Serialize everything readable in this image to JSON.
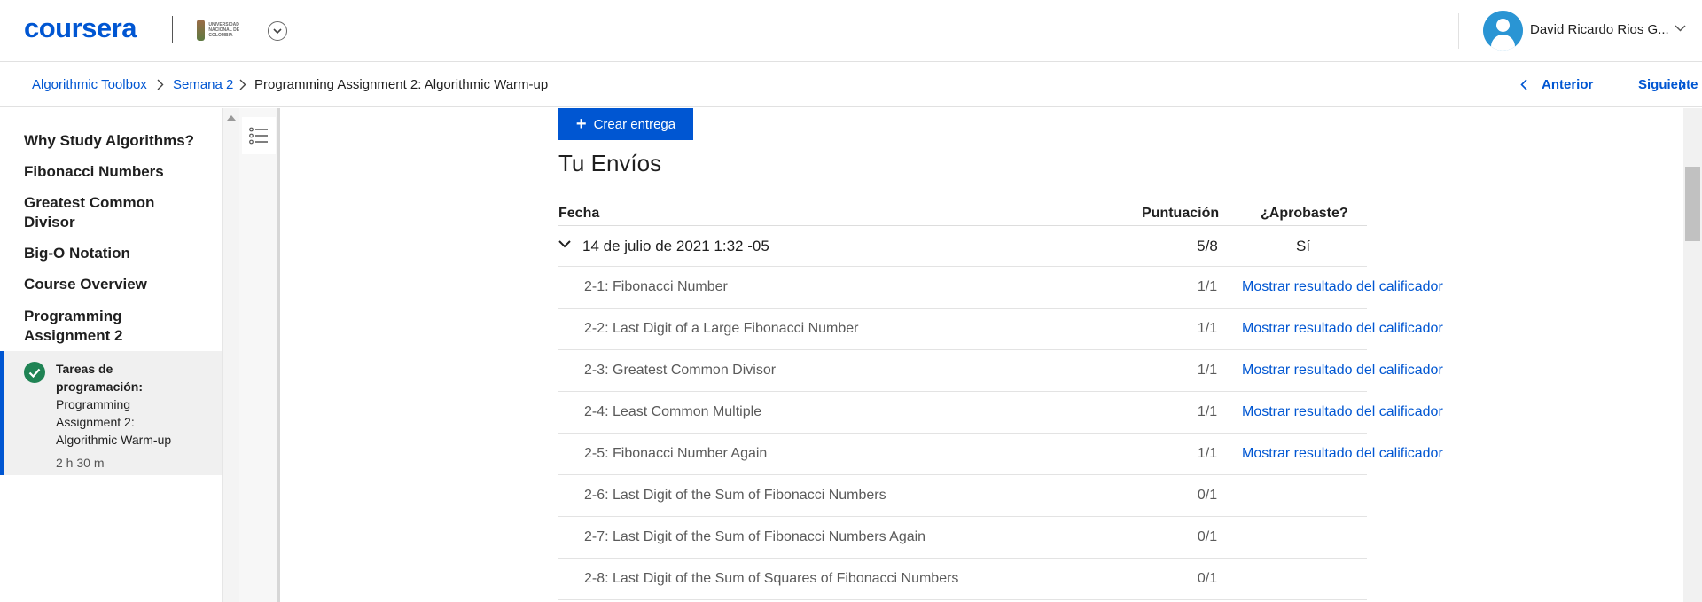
{
  "header": {
    "logo_text": "coursera",
    "partner_text": "UNIVERSIDAD NACIONAL DE COLOMBIA",
    "user_name": "David Ricardo Rios G..."
  },
  "breadcrumb": {
    "items": [
      "Algorithmic Toolbox",
      "Semana 2",
      "Programming Assignment 2: Algorithmic Warm-up"
    ],
    "prev_label": "Anterior",
    "next_label": "Siguiente"
  },
  "sidebar": {
    "items": [
      "Why Study Algorithms?",
      "Fibonacci Numbers",
      "Greatest Common Divisor",
      "Big-O Notation",
      "Course Overview",
      "Programming Assignment 2"
    ],
    "active": {
      "type": "Tareas de programación:",
      "title": "Programming Assignment 2: Algorithmic Warm-up",
      "duration": "2 h 30 m"
    }
  },
  "main": {
    "create_button": "Crear entrega",
    "section_title": "Tu Envíos",
    "columns": {
      "date": "Fecha",
      "score": "Puntuación",
      "passed": "¿Aprobaste?"
    },
    "submission": {
      "date": "14 de julio de 2021 1:32 -05",
      "score": "5/8",
      "passed": "Sí"
    },
    "link_label": "Mostrar resultado del calificador",
    "rows": [
      {
        "name": "2-1: Fibonacci Number",
        "score": "1/1",
        "link": "Mostrar resultado del calificador"
      },
      {
        "name": "2-2: Last Digit of a Large Fibonacci Number",
        "score": "1/1",
        "link": "Mostrar resultado del calificador"
      },
      {
        "name": "2-3: Greatest Common Divisor",
        "score": "1/1",
        "link": "Mostrar resultado del calificador"
      },
      {
        "name": "2-4: Least Common Multiple",
        "score": "1/1",
        "link": "Mostrar resultado del calificador"
      },
      {
        "name": "2-5: Fibonacci Number Again",
        "score": "1/1",
        "link": "Mostrar resultado del calificador"
      },
      {
        "name": "2-6: Last Digit of the Sum of Fibonacci Numbers",
        "score": "0/1",
        "link": ""
      },
      {
        "name": "2-7: Last Digit of the Sum of Fibonacci Numbers Again",
        "score": "0/1",
        "link": ""
      },
      {
        "name": "2-8: Last Digit of the Sum of Squares of Fibonacci Numbers",
        "score": "0/1",
        "link": ""
      }
    ]
  },
  "colors": {
    "brand_blue": "#0056d2",
    "success_green": "#1f8354",
    "avatar_blue": "#2a95d4"
  }
}
